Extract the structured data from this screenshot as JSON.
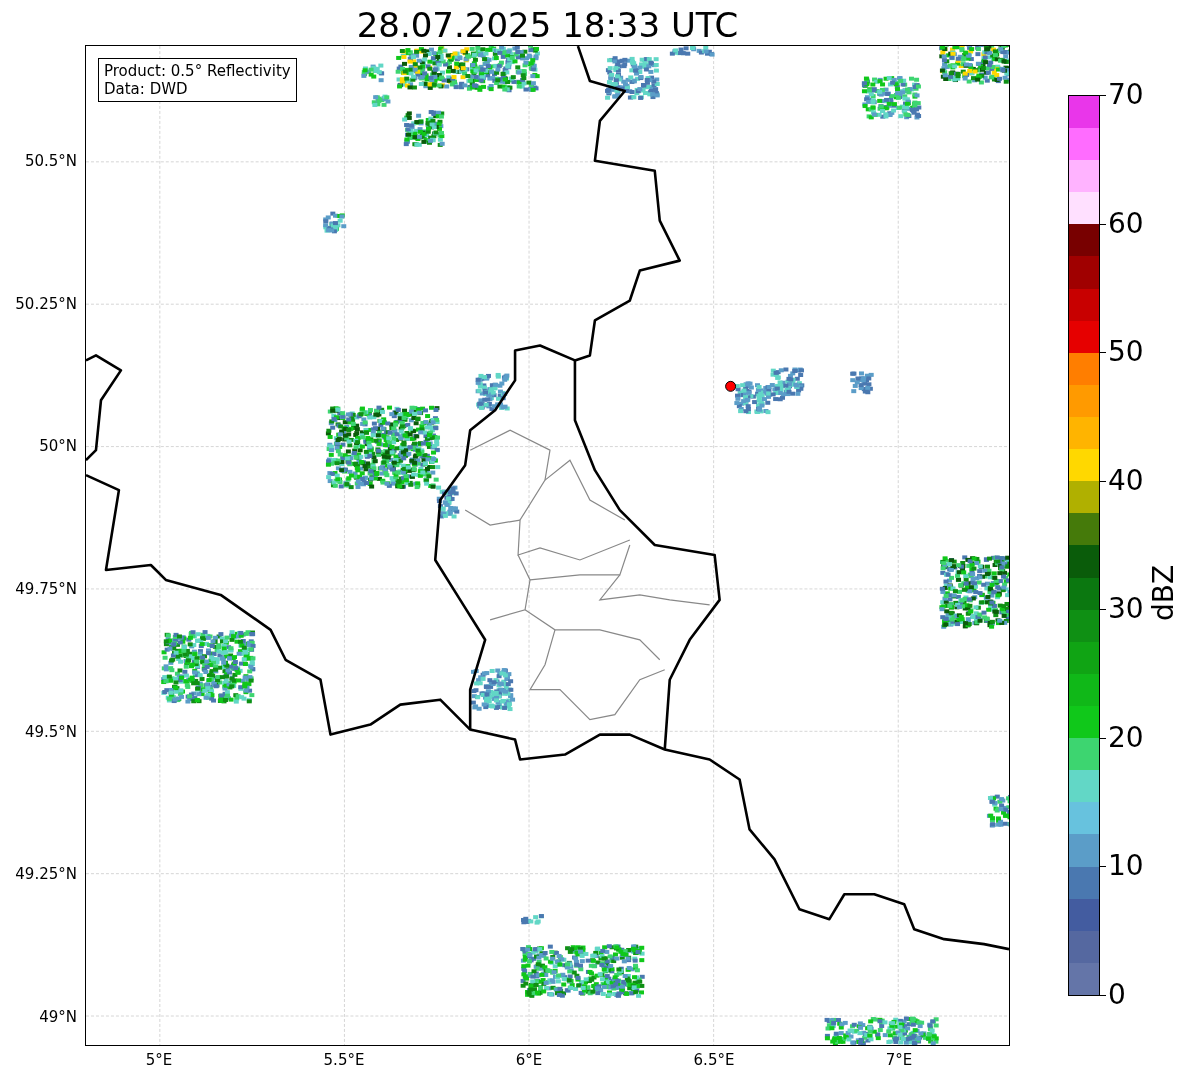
{
  "title": "28.07.2025 18:33 UTC",
  "info_box": {
    "lines": [
      "Product: 0.5° Reflectivity",
      "Data: DWD"
    ]
  },
  "map": {
    "x_ticks": [
      "5°E",
      "5.5°E",
      "6°E",
      "6.5°E",
      "7°E"
    ],
    "y_ticks": [
      "50.5°N",
      "50.25°N",
      "50°N",
      "49.75°N",
      "49.5°N",
      "49.25°N",
      "49°N"
    ]
  },
  "colorbar": {
    "label": "dBZ",
    "ticks": [
      "70",
      "60",
      "50",
      "40",
      "30",
      "20",
      "10",
      "0"
    ]
  }
}
